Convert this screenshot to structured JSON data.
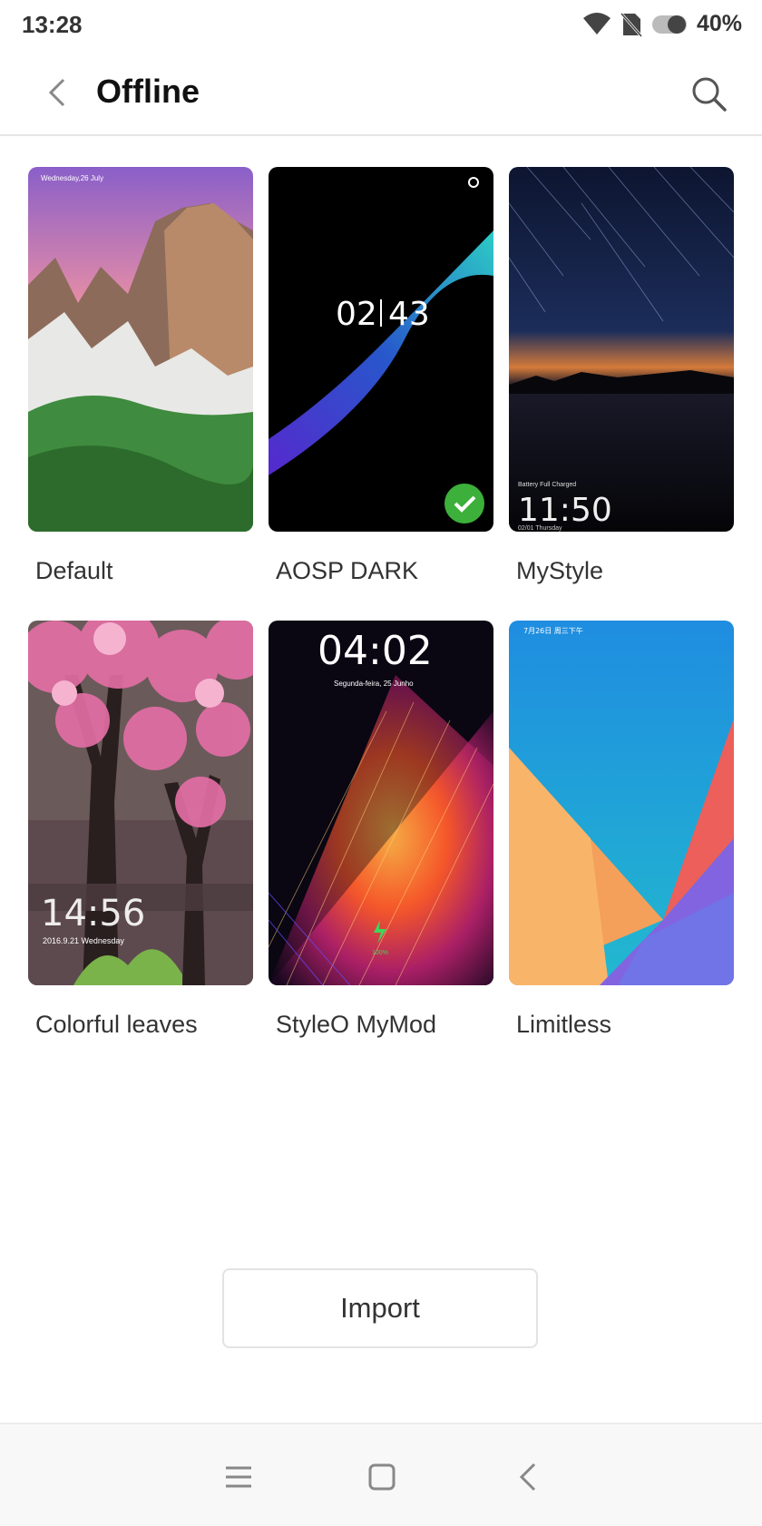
{
  "status": {
    "time": "13:28",
    "battery": "40%"
  },
  "header": {
    "title": "Offline"
  },
  "themes": [
    {
      "name": "Default",
      "preview_texts": {
        "date": "Wednesday,26 July"
      },
      "selected": false
    },
    {
      "name": "AOSP DARK",
      "preview_texts": {
        "clock_h": "02",
        "clock_m": "43"
      },
      "selected": true
    },
    {
      "name": "MyStyle",
      "preview_texts": {
        "status": "Battery Full Charged",
        "clock": "11:50",
        "date": "02/01  Thursday"
      },
      "selected": false
    },
    {
      "name": "Colorful leaves",
      "preview_texts": {
        "clock": "14:56",
        "date": "2016.9.21 Wednesday"
      },
      "selected": false
    },
    {
      "name": "StyleO MyMod",
      "preview_texts": {
        "clock": "04:02",
        "date": "Segunda-feira, 25 Junho",
        "charge": "100%"
      },
      "selected": false
    },
    {
      "name": "Limitless",
      "preview_texts": {
        "date": "7月26日 周三下午"
      },
      "selected": false
    }
  ],
  "actions": {
    "import_label": "Import"
  },
  "colors": {
    "accent_check": "#3cb03a",
    "divider": "#e6e6e6"
  }
}
